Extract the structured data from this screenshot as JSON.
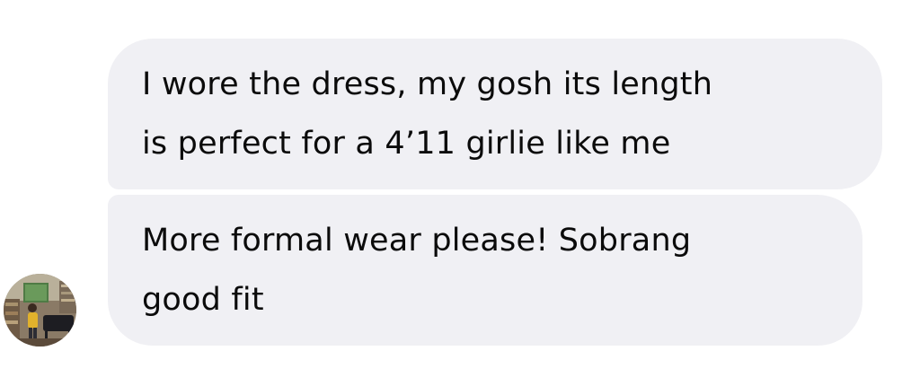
{
  "messages": [
    {
      "text": "I wore the dress, my gosh its length\nis perfect for a 4’11 girlie like me"
    },
    {
      "text": "More formal wear please! Sobrang\ngood fit"
    }
  ],
  "avatar": {
    "icon": "user-avatar-photo"
  },
  "colors": {
    "bubble_background": "#f0f0f4",
    "text": "#0b0b0b",
    "page_background": "#ffffff"
  }
}
